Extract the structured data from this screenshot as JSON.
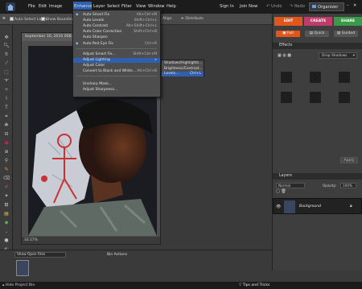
{
  "menubar": {
    "items": [
      "File",
      "Edit",
      "Image",
      "Enhance",
      "Layer",
      "Select",
      "Filter",
      "View",
      "Window",
      "Help"
    ],
    "sign_in": "Sign In",
    "join_now": "Join Now",
    "undo": "Undo",
    "redo": "Redo",
    "organizer": "Organizer"
  },
  "options": {
    "auto_select": "Auto Select Layer",
    "show_bounding": "Show Bounding Box",
    "align": "Align",
    "distribute": "Distribute"
  },
  "document": {
    "title": "September 10, 2010 008.jpg",
    "zoom": "33.17%"
  },
  "enhance_menu": [
    {
      "label": "Auto Smart Fix",
      "shortcut": "Alt+Ctrl+M"
    },
    {
      "label": "Auto Levels",
      "shortcut": "Shift+Ctrl+L"
    },
    {
      "label": "Auto Contrast",
      "shortcut": "Alt+Shift+Ctrl+L"
    },
    {
      "label": "Auto Color Correction",
      "shortcut": "Shift+Ctrl+B"
    },
    {
      "label": "Auto Sharpen",
      "shortcut": ""
    },
    {
      "label": "Auto Red Eye Fix",
      "shortcut": "Ctrl+R"
    },
    {
      "label": "Adjust Smart Fix...",
      "shortcut": "Shift+Ctrl+M"
    },
    {
      "label": "Adjust Lighting",
      "shortcut": ""
    },
    {
      "label": "Adjust Color",
      "shortcut": ""
    },
    {
      "label": "Convert to Black and White...",
      "shortcut": "Alt+Ctrl+B"
    },
    {
      "label": "Unsharp Mask...",
      "shortcut": ""
    },
    {
      "label": "Adjust Sharpness...",
      "shortcut": ""
    }
  ],
  "lighting_submenu": [
    {
      "label": "Shadows/Highlights...",
      "shortcut": ""
    },
    {
      "label": "Brightness/Contrast...",
      "shortcut": ""
    },
    {
      "label": "Levels...",
      "shortcut": "Ctrl+L"
    }
  ],
  "panel": {
    "tabs": [
      "EDIT",
      "CREATE",
      "SHARE"
    ],
    "modes": [
      "Full",
      "Quick",
      "Guided"
    ],
    "effects": "Effects",
    "effects_dropdown": "Drop Shadows",
    "apply": "Apply",
    "layers": "Layers",
    "blend": "Normal",
    "opacity_label": "Opacity:",
    "opacity": "100%",
    "layer_name": "Background"
  },
  "bin": {
    "show_files": "Show Open Files",
    "actions": "Bin Actions"
  },
  "status": {
    "hide_bin": "Hide Project Bin",
    "tips": "Tips and Tricks"
  },
  "colors": {
    "edit_tab": "#e0561b",
    "create_tab": "#c03a6a",
    "share_tab": "#3a9a4a",
    "highlight": "#2f5fae"
  }
}
